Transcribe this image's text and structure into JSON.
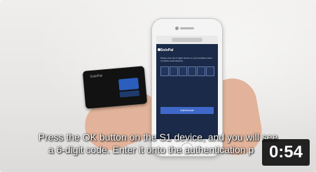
{
  "video": {
    "caption_line1": "Press the OK button on the S1 device, and you will see",
    "caption_line2": "a 6-digit code. Enter it onto the authentication p",
    "duration": "0:54"
  },
  "phone_screen": {
    "brand": "SoloPal",
    "instruction": "Please enter the 6 digits shown on your hardware token to finalize authentication.",
    "button_label": "Authenticate"
  },
  "device": {
    "logo": "SoloPal"
  },
  "colors": {
    "overlay": "#000000",
    "caption_text": "#ffffff",
    "screen_blue": "#1b2a48",
    "accent_button": "#3f68c8"
  }
}
